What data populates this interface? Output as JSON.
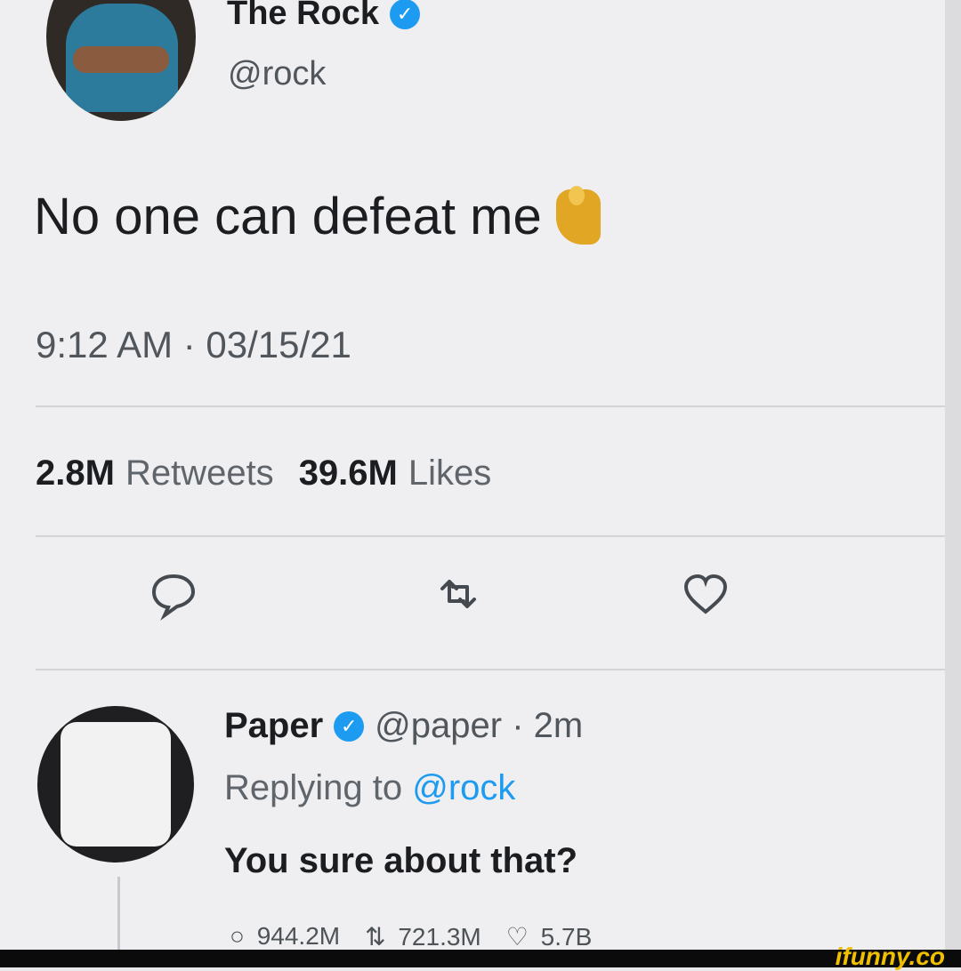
{
  "tweet": {
    "author_name": "The Rock",
    "author_handle": "@rock",
    "text": "No one can defeat me",
    "timestamp": "9:12 AM · 03/15/21",
    "stats": {
      "retweets_value": "2.8M",
      "retweets_label": "Retweets",
      "likes_value": "39.6M",
      "likes_label": "Likes"
    }
  },
  "reply": {
    "author_name": "Paper",
    "meta": "@paper · 2m",
    "replying_prefix": "Replying to",
    "replying_to": "@rock",
    "text": "You sure about that?",
    "counts": {
      "replies": "944.2M",
      "retweets": "721.3M",
      "likes": "5.7B"
    }
  },
  "watermark": "ifunny.co",
  "colors": {
    "accent": "#1d9bf0",
    "text": "#1b1d20",
    "muted": "#60656b",
    "background": "#efeff1"
  },
  "icons": {
    "verified": "verified-badge-icon",
    "reply": "reply-icon",
    "retweet": "retweet-icon",
    "like": "like-icon",
    "emoji": "flexed-biceps-icon"
  }
}
